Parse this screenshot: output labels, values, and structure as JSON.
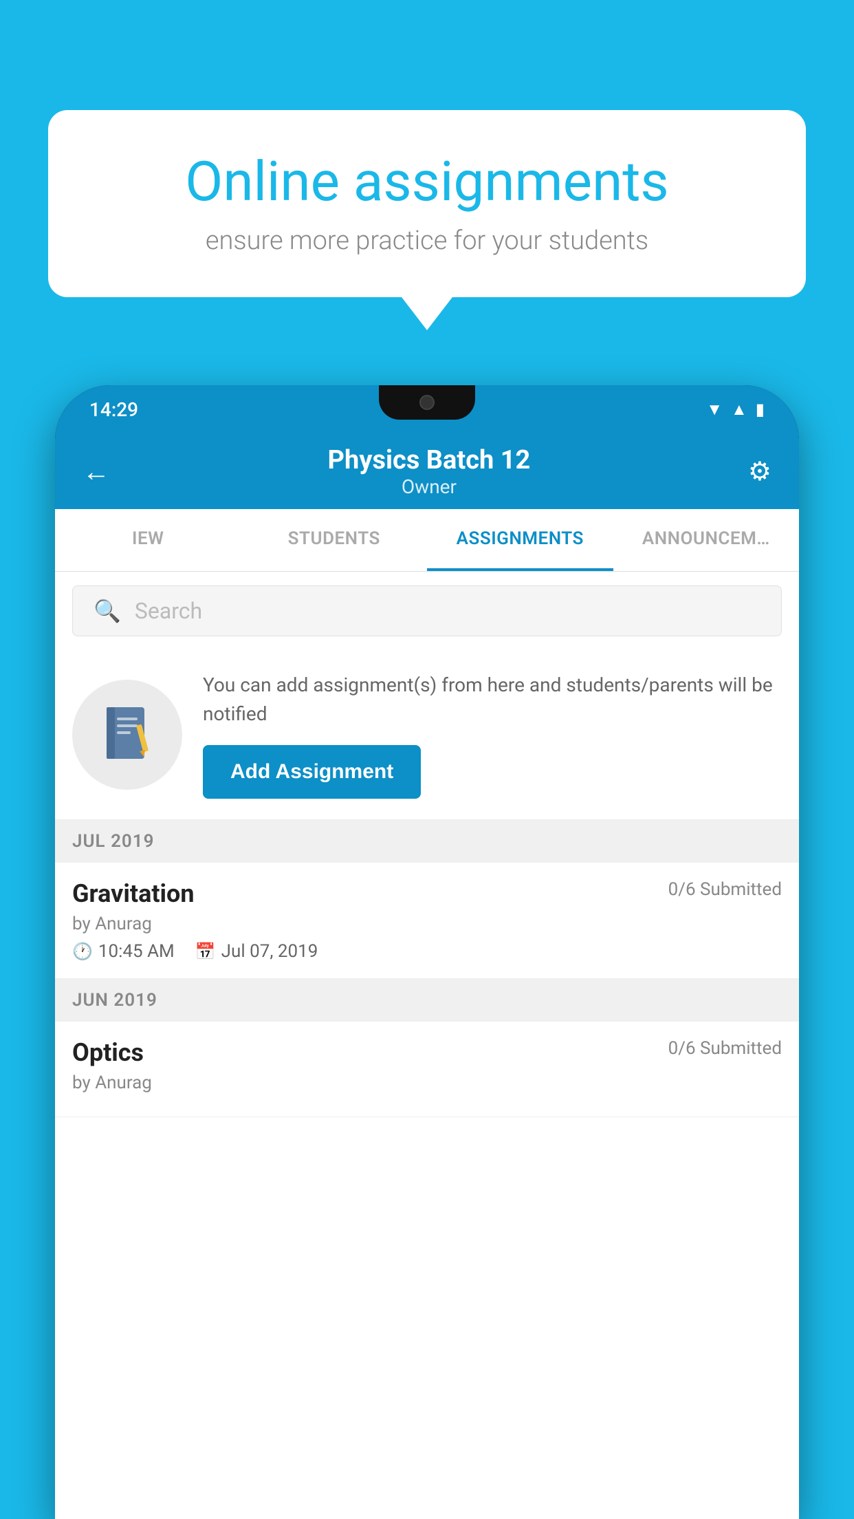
{
  "background_color": "#1ab8e8",
  "speech_bubble": {
    "title": "Online assignments",
    "subtitle": "ensure more practice for your students"
  },
  "status_bar": {
    "time": "14:29",
    "wifi_icon": "wifi",
    "signal_icon": "signal",
    "battery_icon": "battery"
  },
  "app_header": {
    "title": "Physics Batch 12",
    "subtitle": "Owner",
    "back_icon": "←",
    "settings_icon": "⚙"
  },
  "tabs": [
    {
      "label": "IEW",
      "active": false
    },
    {
      "label": "STUDENTS",
      "active": false
    },
    {
      "label": "ASSIGNMENTS",
      "active": true
    },
    {
      "label": "ANNOUNCEM…",
      "active": false
    }
  ],
  "search": {
    "placeholder": "Search"
  },
  "promo": {
    "text": "You can add assignment(s) from here and students/parents will be notified",
    "button_label": "Add Assignment"
  },
  "sections": [
    {
      "label": "JUL 2019",
      "assignments": [
        {
          "name": "Gravitation",
          "submitted": "0/6 Submitted",
          "by": "by Anurag",
          "time": "10:45 AM",
          "date": "Jul 07, 2019"
        }
      ]
    },
    {
      "label": "JUN 2019",
      "assignments": [
        {
          "name": "Optics",
          "submitted": "0/6 Submitted",
          "by": "by Anurag",
          "time": "",
          "date": ""
        }
      ]
    }
  ]
}
